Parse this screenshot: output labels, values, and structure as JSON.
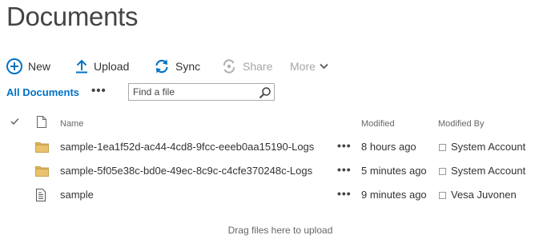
{
  "page": {
    "title": "Documents"
  },
  "commands": {
    "new_label": "New",
    "upload_label": "Upload",
    "sync_label": "Sync",
    "share_label": "Share",
    "more_label": "More"
  },
  "views": {
    "current_label": "All Documents",
    "ellipsis": "•••"
  },
  "search": {
    "placeholder": "Find a file",
    "value": ""
  },
  "columns": {
    "check": "✓",
    "name": "Name",
    "modified": "Modified",
    "modified_by": "Modified By"
  },
  "rows": [
    {
      "type": "folder",
      "name": "sample-1ea1f52d-ac44-4cd8-9fcc-eeeb0aa15190-Logs",
      "ellipsis": "•••",
      "modified": "8 hours ago",
      "modified_by": "System Account"
    },
    {
      "type": "folder",
      "name": "sample-5f05e38c-bd0e-49ec-8c9c-c4cfe370248c-Logs",
      "ellipsis": "•••",
      "modified": "5 minutes ago",
      "modified_by": "System Account"
    },
    {
      "type": "file",
      "name": "sample",
      "ellipsis": "•••",
      "modified": "9 minutes ago",
      "modified_by": "Vesa Juvonen"
    }
  ],
  "drop_hint": "Drag files here to upload",
  "colors": {
    "accent": "#0072c6",
    "folder": "#dcb35c",
    "disabled": "#a6a6a6",
    "text": "#333333"
  },
  "icons": {
    "new": "plus-circle-icon",
    "upload": "upload-arrow-icon",
    "sync": "sync-icon",
    "share": "share-icon",
    "more": "chevron-down-icon",
    "search": "search-icon",
    "column_type": "document-icon",
    "folder": "folder-icon",
    "file": "text-file-icon"
  }
}
